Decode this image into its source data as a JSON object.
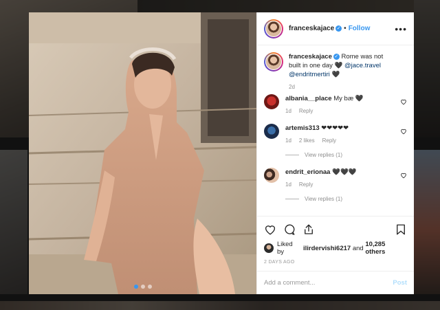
{
  "post": {
    "username": "franceskajace",
    "verified_icon": "verified-check-icon",
    "separator": "•",
    "follow_label": "Follow",
    "more_icon": "more-options-icon",
    "more_label": "•••",
    "caption_text": "Rome was not built in one day 🖤",
    "caption_mentions": [
      "@jace.travel",
      "@endritmertiri"
    ],
    "caption_end": "🖤",
    "caption_age": "2d",
    "carousel_index": 1,
    "carousel_count": 3
  },
  "comments": [
    {
      "username": "albania__place",
      "text": "My bæ 🖤",
      "age": "1d",
      "likes": "",
      "reply_label": "Reply",
      "view_replies": ""
    },
    {
      "username": "artemis313",
      "text": "❤❤❤❤❤",
      "age": "1d",
      "likes": "2 likes",
      "reply_label": "Reply",
      "view_replies": "View replies (1)"
    },
    {
      "username": "endrit_erionaa",
      "text": "🖤🖤🖤",
      "age": "1d",
      "likes": "",
      "reply_label": "Reply",
      "view_replies": "View replies (1)"
    }
  ],
  "actions": {
    "like_icon": "heart-icon",
    "comment_icon": "comment-icon",
    "share_icon": "share-icon",
    "save_icon": "bookmark-icon"
  },
  "likes": {
    "prefix": "Liked by",
    "user": "ilirdervishi6217",
    "and": "and",
    "others": "10,285 others"
  },
  "timestamp": "2 DAYS AGO",
  "comment_box": {
    "placeholder": "Add a comment...",
    "post_label": "Post"
  },
  "colors": {
    "accent": "#3897f0",
    "post_disabled": "#b2dffc",
    "text": "#262626",
    "muted": "#8e8e8e"
  }
}
